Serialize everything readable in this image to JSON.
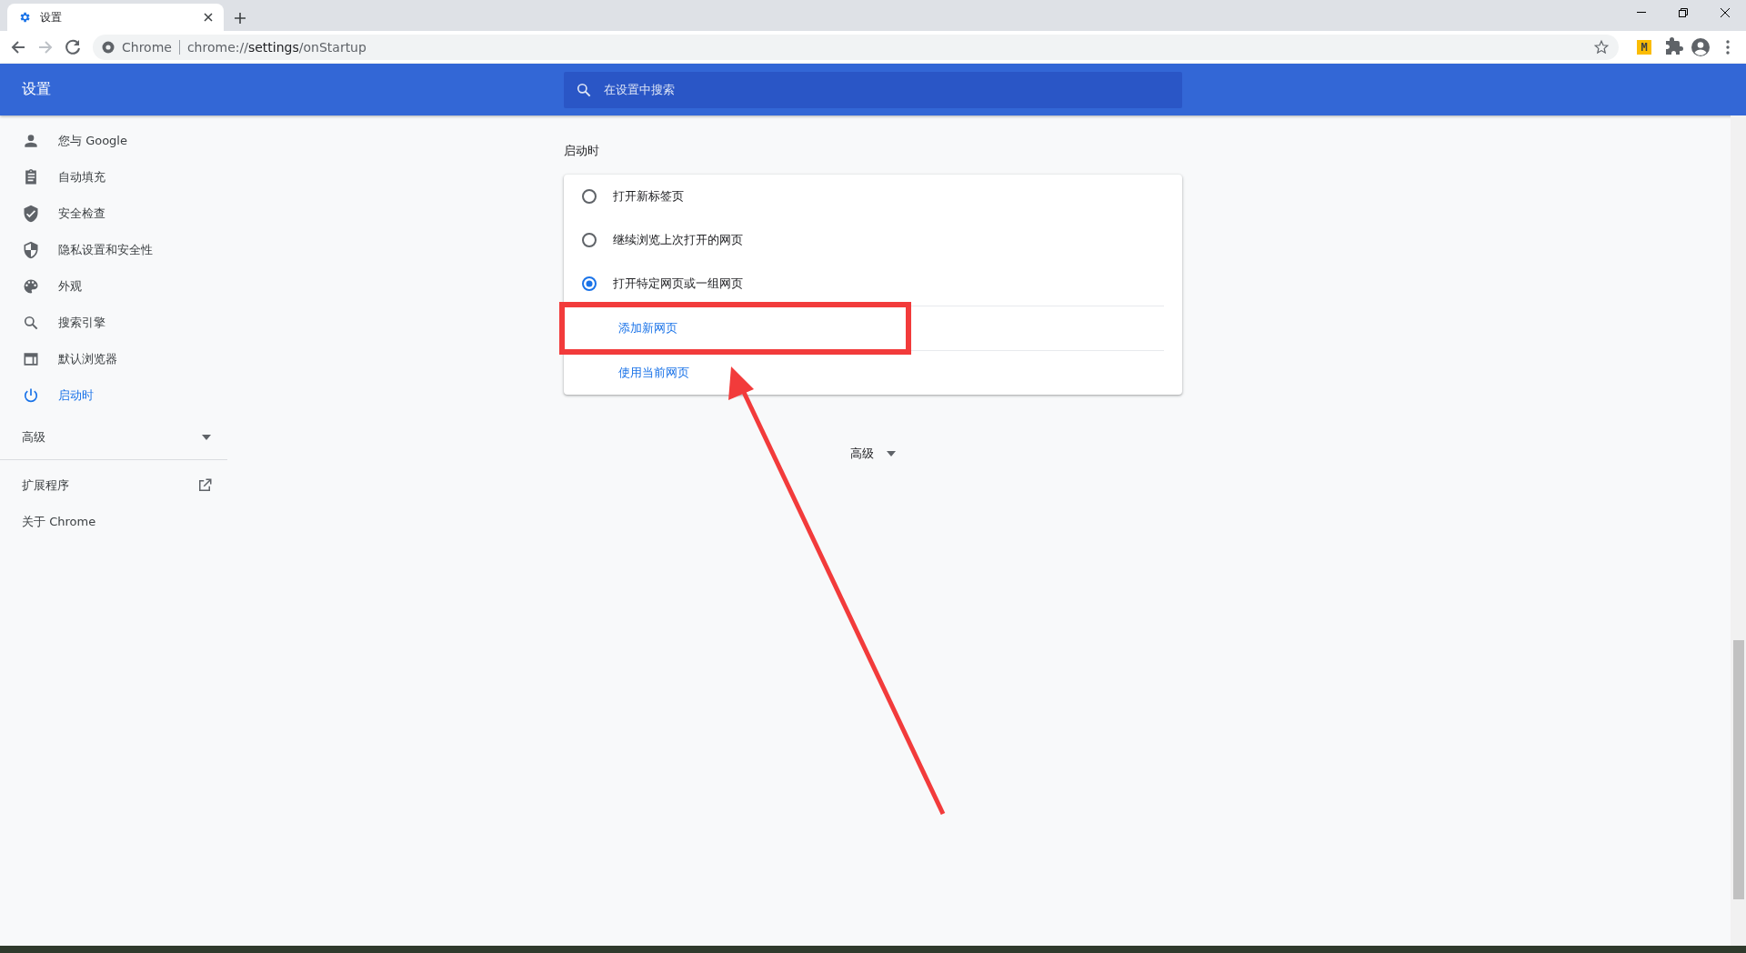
{
  "tab": {
    "title": "设置",
    "selected": true
  },
  "address_bar": {
    "origin": "Chrome",
    "url_prefix": "chrome://",
    "url_host": "settings",
    "url_path": "/onStartup"
  },
  "extension_badge": "M",
  "header": {
    "title": "设置",
    "search": {
      "placeholder": "在设置中搜索"
    }
  },
  "sidebar": {
    "items": [
      {
        "label": "您与 Google",
        "selected": false
      },
      {
        "label": "自动填充",
        "selected": false
      },
      {
        "label": "安全检查",
        "selected": false
      },
      {
        "label": "隐私设置和安全性",
        "selected": false
      },
      {
        "label": "外观",
        "selected": false
      },
      {
        "label": "搜索引擎",
        "selected": false
      },
      {
        "label": "默认浏览器",
        "selected": false
      },
      {
        "label": "启动时",
        "selected": true
      }
    ],
    "advanced": {
      "label": "高级",
      "expanded": false
    },
    "extensions": "扩展程序",
    "about": "关于 Chrome"
  },
  "section": {
    "title": "启动时",
    "options": [
      {
        "label": "打开新标签页",
        "selected": false
      },
      {
        "label": "继续浏览上次打开的网页",
        "selected": false
      },
      {
        "label": "打开特定网页或一组网页",
        "selected": true
      }
    ],
    "links": [
      "添加新网页",
      "使用当前网页"
    ]
  },
  "advanced_toggle": {
    "label": "高级",
    "expanded": false
  }
}
